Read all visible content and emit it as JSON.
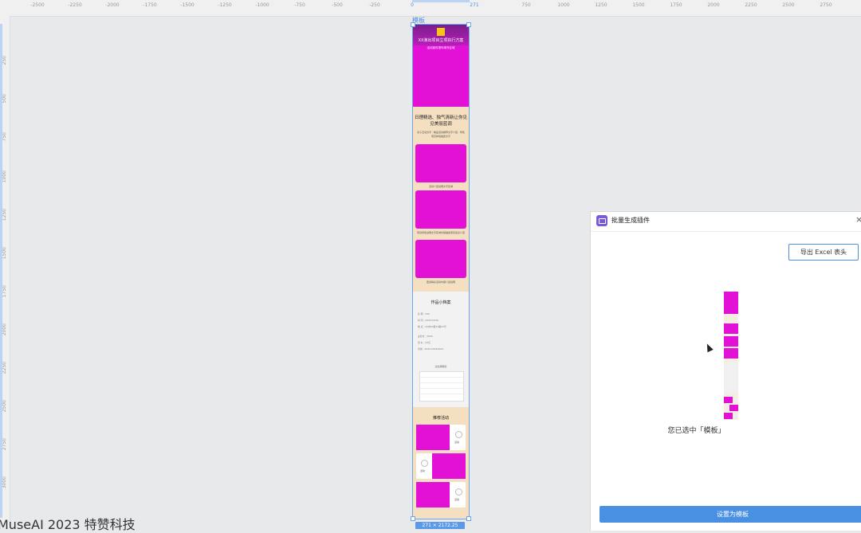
{
  "ruler": {
    "top_ticks": [
      "-2500",
      "-2250",
      "-2000",
      "-1750",
      "-1500",
      "-1250",
      "-1000",
      "-750",
      "-500",
      "-250",
      "0",
      "271",
      "750",
      "1000",
      "1250",
      "1500",
      "1750",
      "2000",
      "2250",
      "2500",
      "2750"
    ],
    "left_ticks": [
      "250",
      "500",
      "750",
      "1000",
      "1250",
      "1500",
      "1750",
      "2000",
      "2250",
      "2500",
      "2750",
      "3000"
    ]
  },
  "artboard": {
    "label": "模板",
    "size_badge": "271 × 2172.25",
    "hero_title": "XX演出项目立项执行方案",
    "hero_subtitle": "活动宣传语句填写区域",
    "section1_heading": "日理精选、独气清新让你见见美丽蓝调",
    "section1_text": "亲子互动文字 · 精品活动推荐文字介绍 · 特色项目体验描述文字",
    "caption1": "活动介绍说明文字区域",
    "caption2": "项目特色说明文字区域内容描述项目亮点介绍",
    "caption3": "更多精彩活动内容介绍说明",
    "section2_title": "作品小档案",
    "info_rows": [
      "名 称：XXX",
      "时 间：XXXX-XX-XX",
      "地 点：XX市XX区XX路XX号",
      "主办方：XXXX",
      "票 价：XX元",
      "咨询：XXXX-XXXXXXXX"
    ],
    "table_title": "演出排期表",
    "section3_title": "推荐活动",
    "card_labels": [
      "活动",
      "活动",
      "活动"
    ]
  },
  "footer": {
    "text": "MuseAI 2023 特赞科技"
  },
  "panel": {
    "title": "批量生成插件",
    "close": "×",
    "export_button": "导出 Excel 表头",
    "selected_text": "您已选中「模板」",
    "primary_button": "设置为模板"
  }
}
